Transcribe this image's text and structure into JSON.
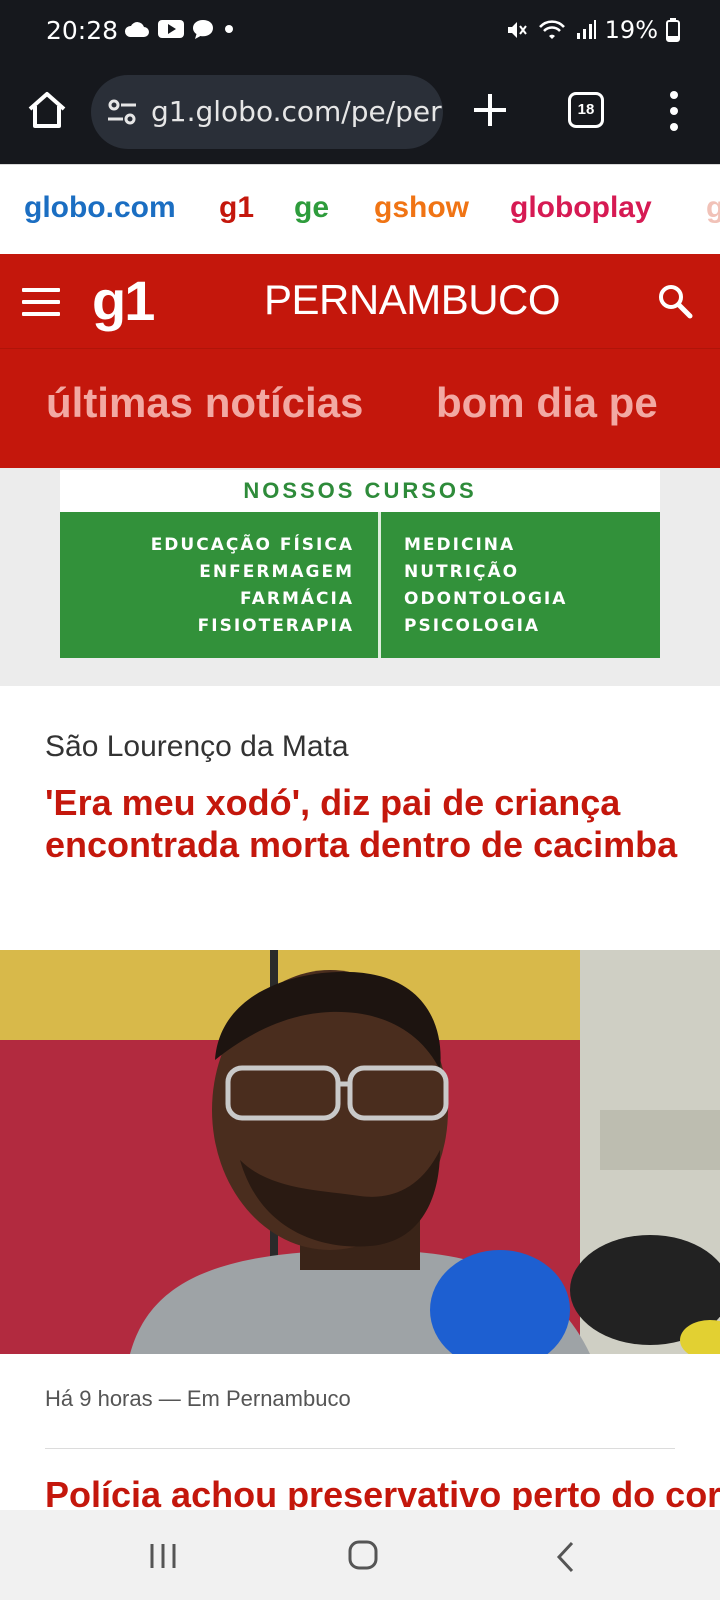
{
  "status_bar": {
    "time": "20:28",
    "battery": "19%",
    "left_icons": [
      "cloud-icon",
      "youtube-icon",
      "chat-icon",
      "dot-icon"
    ],
    "right_icons": [
      "mute-icon",
      "wifi-icon",
      "signal-icon",
      "battery-icon"
    ]
  },
  "browser": {
    "url": "g1.globo.com/pe/per",
    "tab_count": "18"
  },
  "network_links": [
    {
      "label": "globo.com",
      "color": "#1b6ec2"
    },
    {
      "label": "g1",
      "color": "#c4170c"
    },
    {
      "label": "ge",
      "color": "#2e9c3c"
    },
    {
      "label": "gshow",
      "color": "#f07414"
    },
    {
      "label": "globoplay",
      "color": "#d61a53"
    },
    {
      "label": "g",
      "color": "#f1c2b8"
    }
  ],
  "header": {
    "logo": "g1",
    "region": "PERNAMBUCO"
  },
  "sub_nav": {
    "items": [
      "últimas notícias",
      "bom dia pe"
    ]
  },
  "ad": {
    "title": "NOSSOS CURSOS",
    "left_courses": [
      "EDUCAÇÃO FÍSICA",
      "ENFERMAGEM",
      "FARMÁCIA",
      "FISIOTERAPIA"
    ],
    "right_courses": [
      "MEDICINA",
      "NUTRIÇÃO",
      "ODONTOLOGIA",
      "PSICOLOGIA"
    ]
  },
  "article": {
    "section": "São Lourenço da Mata",
    "headline": "'Era meu xodó', diz pai de criança encontrada morta dentro de cacimba",
    "meta": "Há 9 horas — Em Pernambuco",
    "next_headline": "Polícia achou preservativo perto do corpo e"
  },
  "colors": {
    "g1_red": "#c4170c",
    "subnav_text": "#f2a9a3",
    "ad_green": "#32913a"
  }
}
